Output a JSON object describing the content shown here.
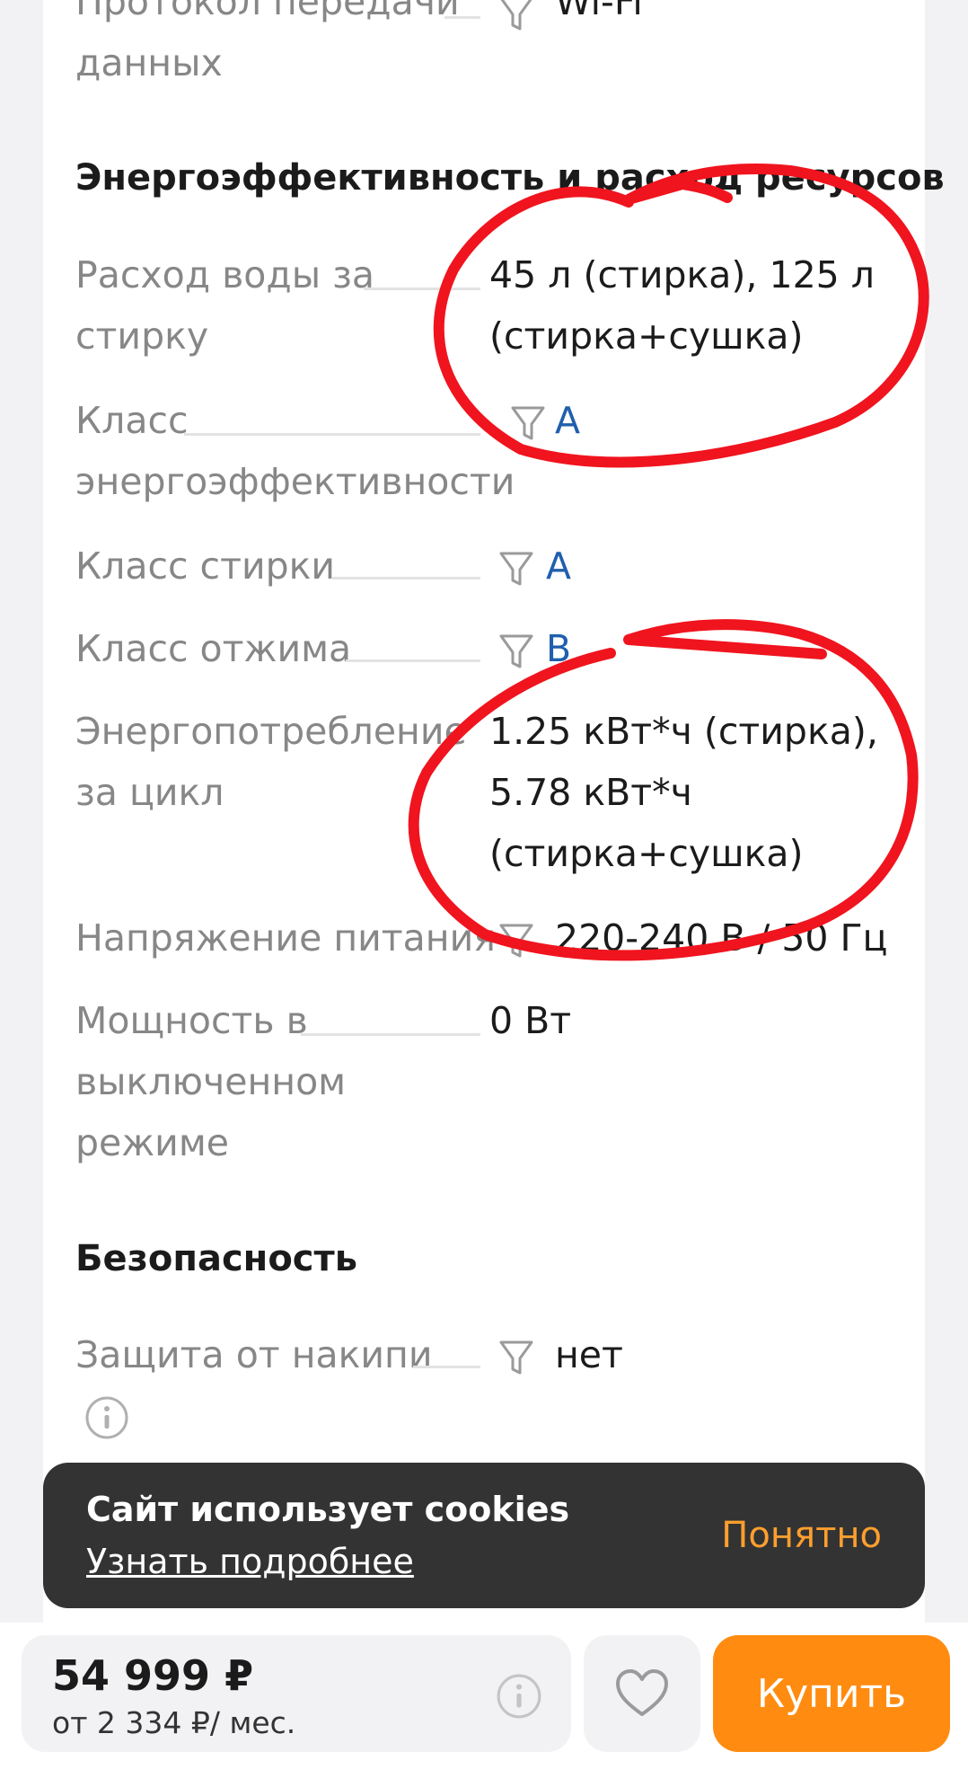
{
  "specs": {
    "protocol": {
      "label_line1": "Протокол передачи",
      "label_line2": "данных",
      "value": "Wi-Fi"
    },
    "energy_section_title": "Энергоэффективность и расход ресурсов",
    "water": {
      "label_line1": "Расход воды за",
      "label_line2": "стирку",
      "value_line1": "45 л (стирка), 125 л",
      "value_line2": "(стирка+сушка)"
    },
    "energy_class": {
      "label_line1": "Класс",
      "label_line2": "энергоэффективности",
      "value": "A"
    },
    "wash_class": {
      "label": "Класс стирки",
      "value": "A"
    },
    "spin_class": {
      "label": "Класс отжима",
      "value": "B"
    },
    "consumption": {
      "label_line1": "Энергопотребление",
      "label_line2": "за цикл",
      "value_line1": "1.25 кВт*ч (стирка),",
      "value_line2": "5.78 кВт*ч",
      "value_line3": "(стирка+сушка)"
    },
    "voltage": {
      "label": "Напряжение питания",
      "value": "220-240 В / 50 Гц"
    },
    "standby": {
      "label_line1": "Мощность в",
      "label_line2": "выключенном",
      "label_line3": "режиме",
      "value": "0 Вт"
    },
    "safety_section_title": "Безопасность",
    "scale": {
      "label": "Защита от накипи",
      "value": "нет"
    }
  },
  "cookie_banner": {
    "title": "Сайт использует cookies",
    "link": "Узнать подробнее",
    "button": "Понятно"
  },
  "purchase": {
    "price": "54 999 ₽",
    "installment": "от 2 334 ₽/ мес.",
    "buy_button": "Купить"
  },
  "colors": {
    "accent": "#ff8c10",
    "link": "#1f5fad",
    "annotation": "#f0141e",
    "toast_bg": "#333333"
  },
  "icons": [
    "filter-icon",
    "info-icon",
    "heart-icon"
  ]
}
